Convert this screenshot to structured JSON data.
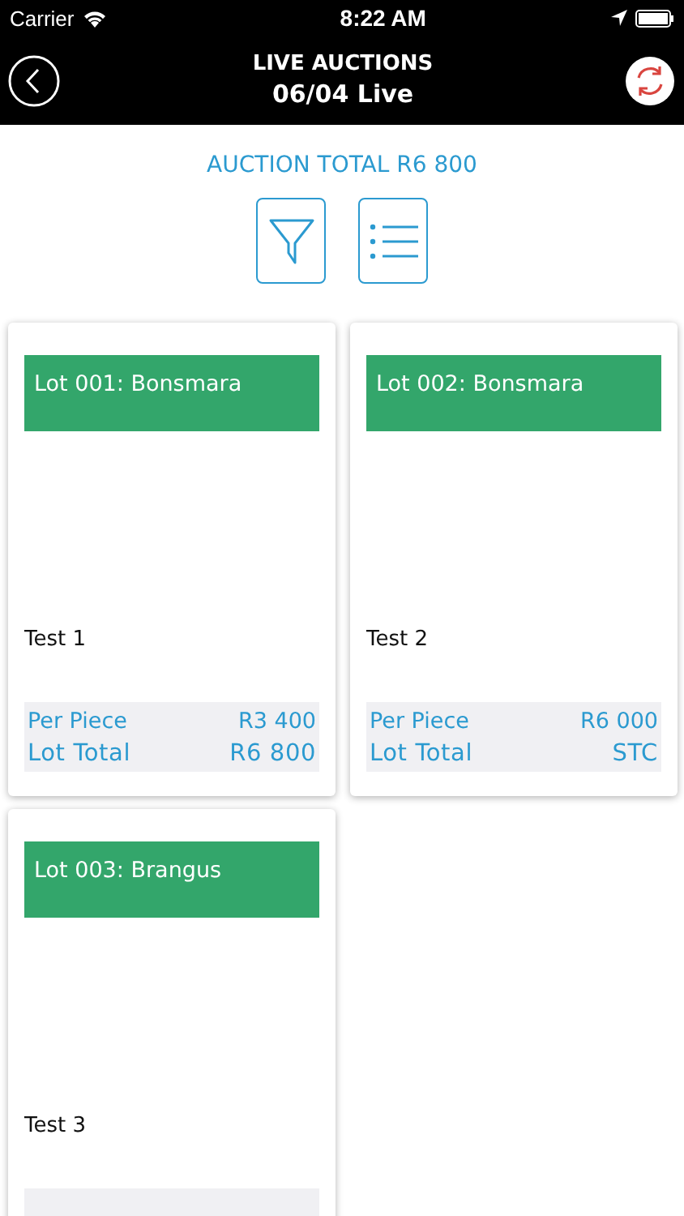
{
  "status_bar": {
    "carrier": "Carrier",
    "time": "8:22 AM"
  },
  "header": {
    "title": "LIVE AUCTIONS",
    "subtitle": "06/04 Live"
  },
  "auction_total": "AUCTION TOTAL R6 800",
  "lots": [
    {
      "title": "Lot 001: Bonsmara",
      "description": "Test 1",
      "prices": [
        {
          "label": "Per Piece",
          "value": "R3 400",
          "kind": "normal"
        },
        {
          "label": "Lot Total",
          "value": "R6 800",
          "kind": "total"
        }
      ]
    },
    {
      "title": "Lot 002: Bonsmara",
      "description": "Test 2",
      "prices": [
        {
          "label": "Per Piece",
          "value": "R6 000",
          "kind": "normal"
        },
        {
          "label": "Lot Total",
          "value": "STC",
          "kind": "total"
        }
      ]
    },
    {
      "title": "Lot 003: Brangus",
      "description": "Test 3"
    }
  ]
}
